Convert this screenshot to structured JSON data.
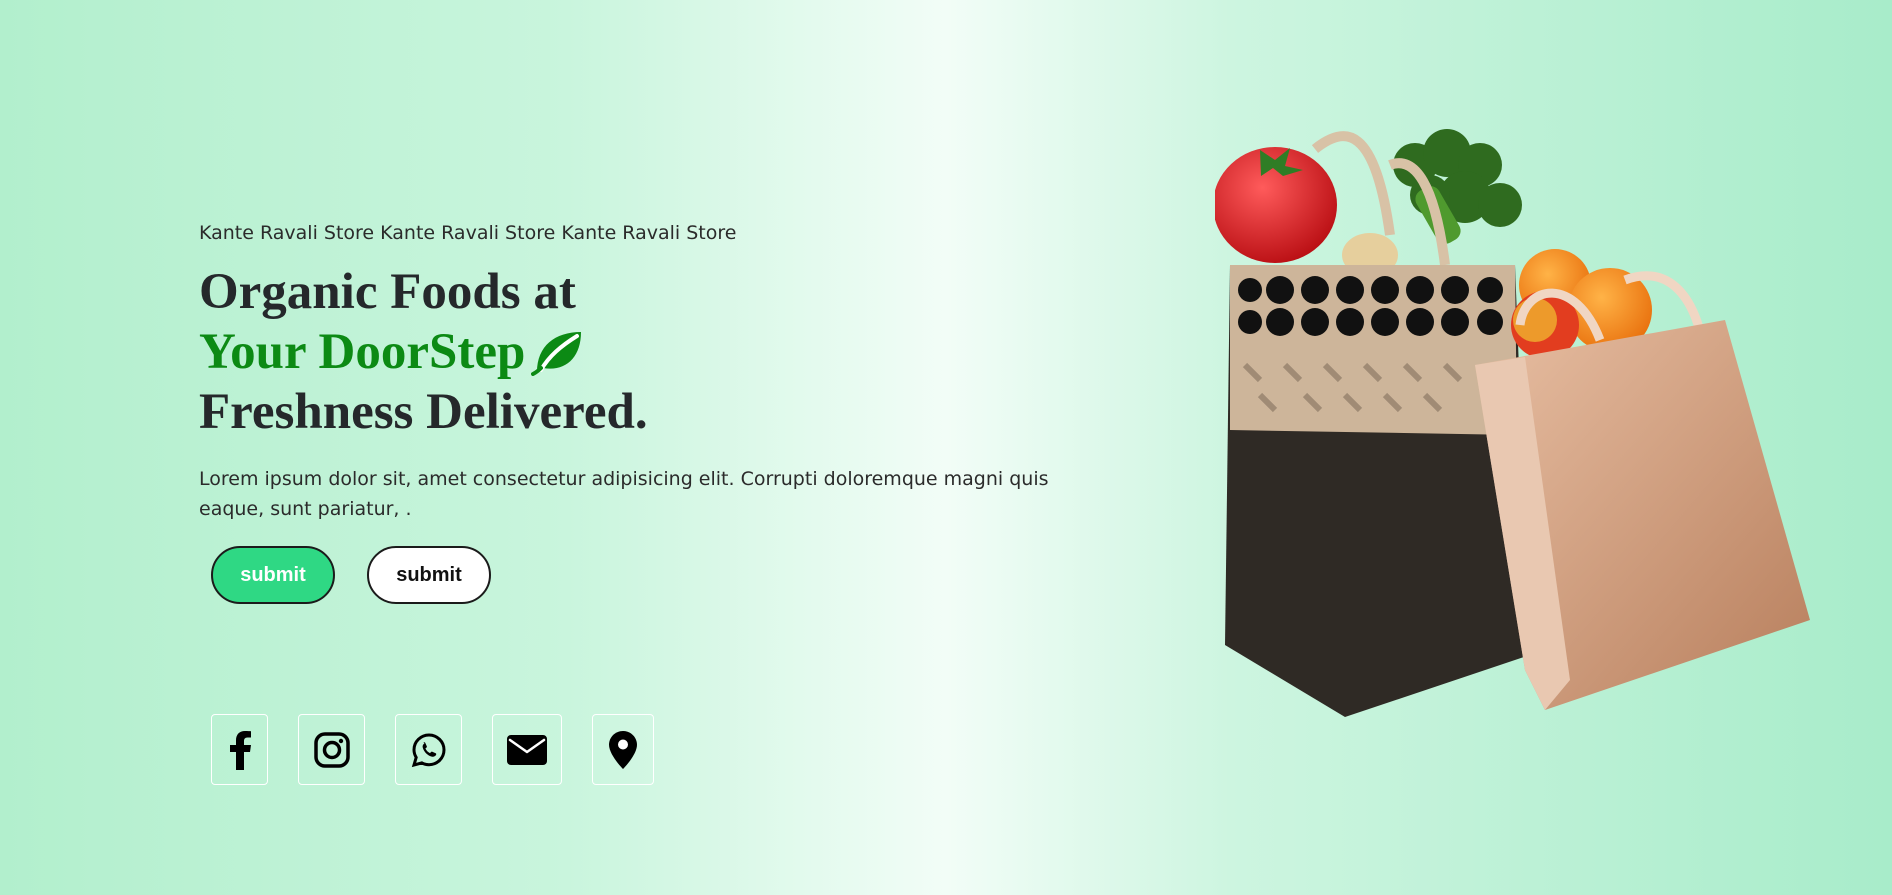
{
  "hero": {
    "tagline": "Kante Ravali Store Kante Ravali Store Kante Ravali Store",
    "headline_line1": "Organic Foods at",
    "headline_line2": "Your DoorStep",
    "headline_line3": "Freshness Delivered.",
    "description": "Lorem ipsum dolor sit, amet consectetur adipisicing elit. Corrupti doloremque magni quis eaque, sunt pariatur, .",
    "primary_button": "submit",
    "secondary_button": "submit"
  },
  "socials": [
    {
      "icon": "facebook-icon"
    },
    {
      "icon": "instagram-icon"
    },
    {
      "icon": "whatsapp-icon"
    },
    {
      "icon": "envelope-icon"
    },
    {
      "icon": "map-pin-icon"
    }
  ],
  "colors": {
    "accent_green": "#0c8a14",
    "button_green": "#2fd884",
    "background_mint": "#b2efcd"
  }
}
